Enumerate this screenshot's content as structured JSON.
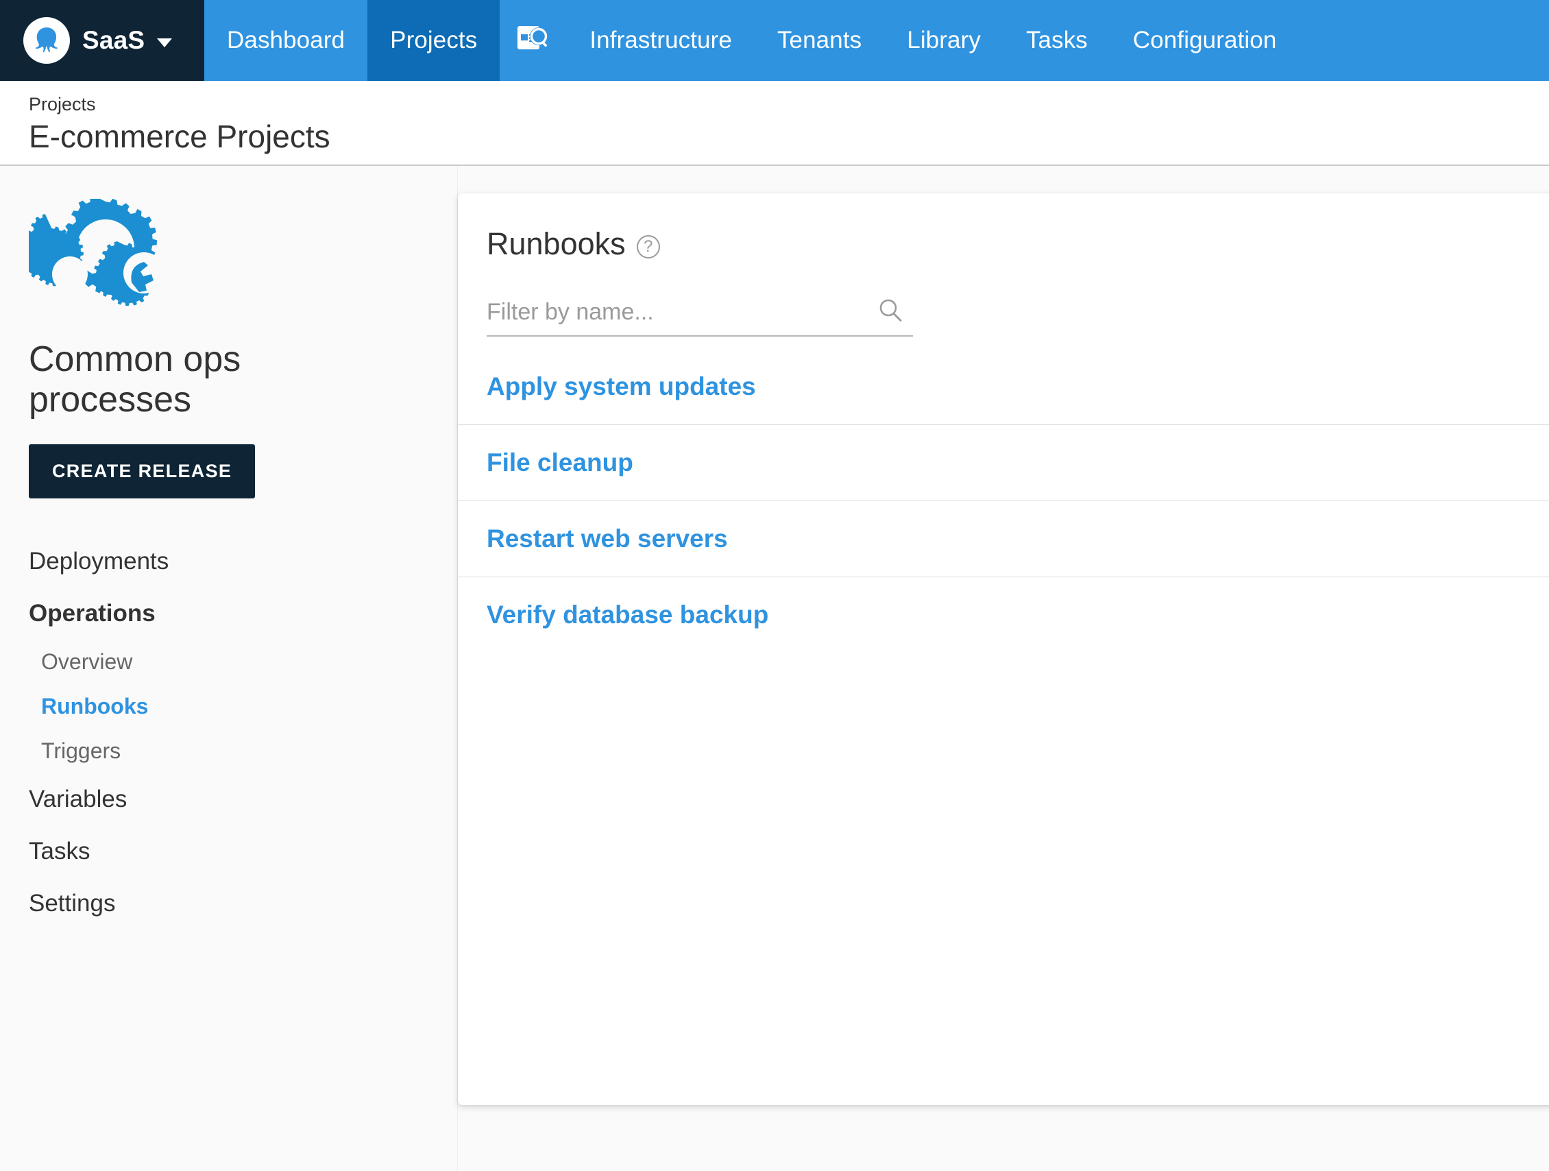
{
  "topnav": {
    "brand": {
      "label": "SaaS",
      "logo_icon": "octopus-logo-icon",
      "caret_icon": "chevron-down-icon"
    },
    "items": [
      {
        "label": "Dashboard",
        "active": false
      },
      {
        "label": "Projects",
        "active": true
      },
      {
        "label": "",
        "icon": "document-search-icon",
        "active": false
      },
      {
        "label": "Infrastructure",
        "active": false
      },
      {
        "label": "Tenants",
        "active": false
      },
      {
        "label": "Library",
        "active": false
      },
      {
        "label": "Tasks",
        "active": false
      },
      {
        "label": "Configuration",
        "active": false
      }
    ],
    "colors": {
      "bar": "#2f93e0",
      "active_tab": "#0d6cb5",
      "brand_bg": "#0f2535"
    }
  },
  "header": {
    "breadcrumb": "Projects",
    "title": "E-commerce Projects"
  },
  "sidebar": {
    "project_logo_icon": "gears-cloud-icon",
    "project_title": "Common ops processes",
    "create_release_label": "CREATE RELEASE",
    "items": [
      {
        "label": "Deployments",
        "level": "top",
        "bold": false,
        "selected": false
      },
      {
        "label": "Operations",
        "level": "top",
        "bold": true,
        "selected": false
      },
      {
        "label": "Overview",
        "level": "sub",
        "bold": false,
        "selected": false
      },
      {
        "label": "Runbooks",
        "level": "sub",
        "bold": true,
        "selected": true
      },
      {
        "label": "Triggers",
        "level": "sub",
        "bold": false,
        "selected": false
      },
      {
        "label": "Variables",
        "level": "top",
        "bold": false,
        "selected": false
      },
      {
        "label": "Tasks",
        "level": "top",
        "bold": false,
        "selected": false
      },
      {
        "label": "Settings",
        "level": "top",
        "bold": false,
        "selected": false
      }
    ],
    "accent_color": "#2f93e0"
  },
  "main": {
    "card_title": "Runbooks",
    "help_icon": "question-mark-circle-icon",
    "help_glyph": "?",
    "filter": {
      "placeholder": "Filter by name...",
      "value": "",
      "icon": "search-icon"
    },
    "runbooks": [
      {
        "name": "Apply system updates"
      },
      {
        "name": "File cleanup"
      },
      {
        "name": "Restart web servers"
      },
      {
        "name": "Verify database backup"
      }
    ],
    "link_color": "#2f93e0"
  }
}
